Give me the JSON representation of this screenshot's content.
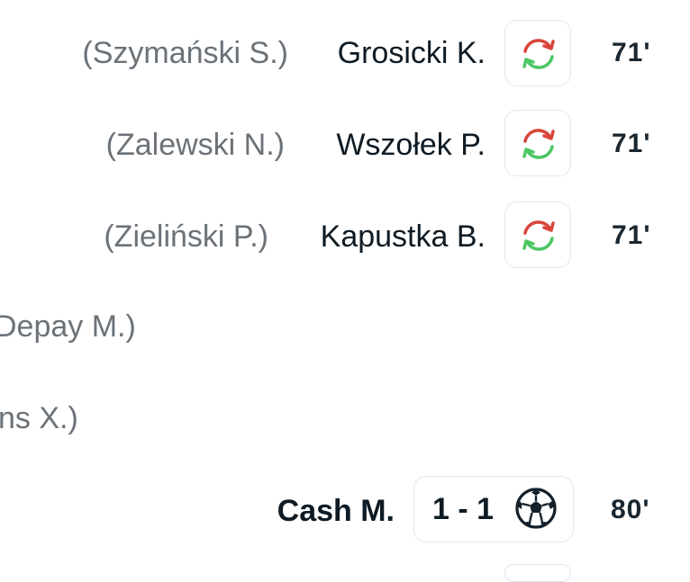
{
  "events": [
    {
      "type": "substitution",
      "player_out": "(Szymański S.)",
      "player_in": "Grosicki K.",
      "icon": "substitution-arrows-icon",
      "minute": "71'"
    },
    {
      "type": "substitution",
      "player_out": "(Zalewski N.)",
      "player_in": "Wszołek P.",
      "icon": "substitution-arrows-icon",
      "minute": "71'"
    },
    {
      "type": "substitution",
      "player_out": "(Zieliński P.)",
      "player_in": "Kapustka B.",
      "icon": "substitution-arrows-icon",
      "minute": "71'"
    },
    {
      "type": "substitution-away",
      "player_out_partial": "Depay M.)"
    },
    {
      "type": "substitution-away",
      "player_out_partial": "ns X.)"
    },
    {
      "type": "goal",
      "scorer": "Cash M.",
      "score": "1 - 1",
      "icon": "soccer-ball-icon",
      "minute": "80'"
    }
  ],
  "colors": {
    "sub_out_text": "#6b7278",
    "player_text": "#0f1b24",
    "arrow_red": "#d9453a",
    "arrow_green": "#4cc764",
    "badge_border": "#e4e6e8"
  }
}
